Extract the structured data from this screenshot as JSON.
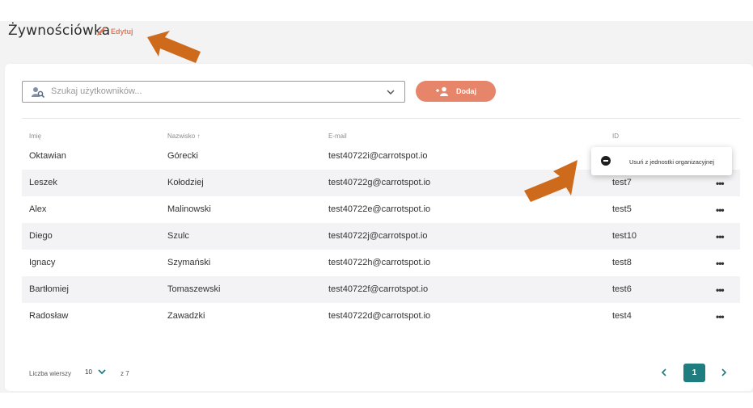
{
  "header": {
    "title": "Żywnościówka",
    "edit_label": "Edytuj"
  },
  "toolbar": {
    "search_placeholder": "Szukaj użytkowników...",
    "add_label": "Dodaj"
  },
  "table": {
    "columns": [
      "Imię",
      "Nazwisko ↑",
      "E-mail",
      "ID"
    ],
    "rows": [
      {
        "first": "Oktawian",
        "last": "Górecki",
        "email": "test40722i@carrotspot.io",
        "id": ""
      },
      {
        "first": "Leszek",
        "last": "Kołodziej",
        "email": "test40722g@carrotspot.io",
        "id": "test7"
      },
      {
        "first": "Alex",
        "last": "Malinowski",
        "email": "test40722e@carrotspot.io",
        "id": "test5"
      },
      {
        "first": "Diego",
        "last": "Szulc",
        "email": "test40722j@carrotspot.io",
        "id": "test10"
      },
      {
        "first": "Ignacy",
        "last": "Szymański",
        "email": "test40722h@carrotspot.io",
        "id": "test8"
      },
      {
        "first": "Bartłomiej",
        "last": "Tomaszewski",
        "email": "test40722f@carrotspot.io",
        "id": "test6"
      },
      {
        "first": "Radosław",
        "last": "Zawadzki",
        "email": "test40722d@carrotspot.io",
        "id": "test4"
      }
    ],
    "more_label": "•••"
  },
  "context_menu": {
    "item_label": "Usuń z jednostki organizacyjnej"
  },
  "footer": {
    "rows_label": "Liczba wierszy",
    "rows_value": "10",
    "of_label": "z 7",
    "current_page": "1"
  },
  "colors": {
    "accent": "#e6856a",
    "edit": "#e07b5f",
    "page_active": "#1f7c7f",
    "annotation_arrow": "#d2691e"
  },
  "icons": [
    "pencil-icon",
    "user-search-icon",
    "chevron-down-icon",
    "add-user-icon",
    "minus-circle-icon",
    "more-icon",
    "chevron-left-icon",
    "chevron-right-icon",
    "arrow-annotation"
  ]
}
